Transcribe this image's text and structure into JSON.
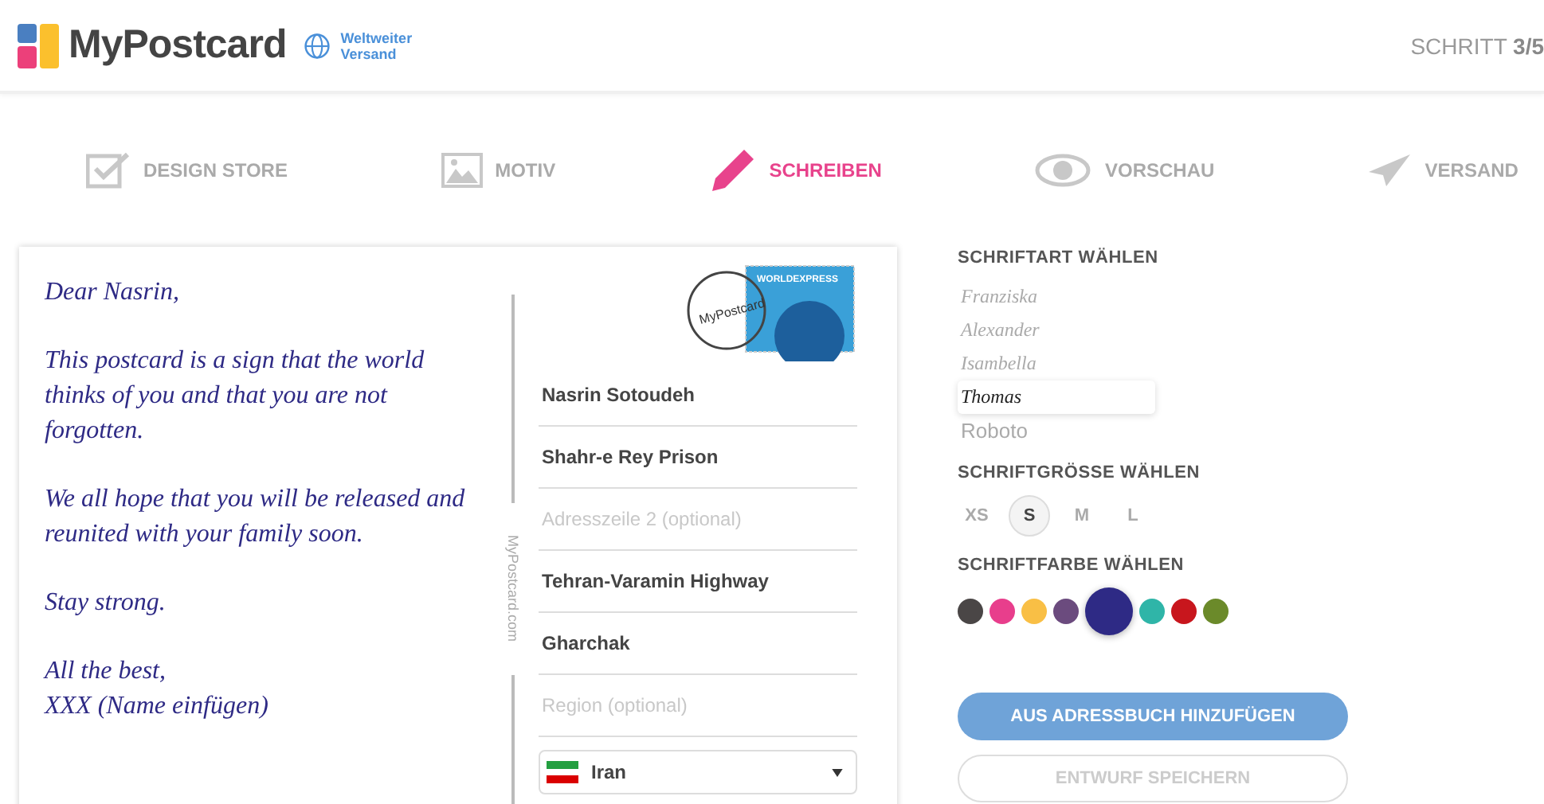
{
  "header": {
    "brand": "MyPostcard",
    "badge_line_1": "Weltweiter",
    "badge_line_2": "Versand",
    "step": "SCHRITT",
    "step_count": "3/5"
  },
  "steps": [
    {
      "label": "DESIGN STORE",
      "kind": "check",
      "selected": false
    },
    {
      "label": "MOTIV",
      "kind": "image",
      "selected": false
    },
    {
      "label": "SCHREIBEN",
      "kind": "pencil",
      "selected": true
    },
    {
      "label": "VORSCHAU",
      "kind": "eye",
      "selected": false
    },
    {
      "label": "VERSAND",
      "kind": "plane",
      "selected": false
    }
  ],
  "postcard": {
    "message": [
      "Dear Nasrin,",
      "This postcard is a sign that the world thinks of you and that you are not forgotten.",
      "We all hope that you will be released and reunited with your family soon.",
      "Stay strong.",
      "All the best,\nXXX (Name einfügen)"
    ],
    "side_text": "MyPostcard.com",
    "stamp_text": "WORLDEXPRESS",
    "postmark_text": "MyPostcard",
    "address": [
      {
        "value": "Nasrin Sotoudeh"
      },
      {
        "value": "Shahr-e Rey Prison"
      },
      {
        "placeholder": "Adresszeile 2 (optional)"
      },
      {
        "value": "Tehran-Varamin Highway"
      },
      {
        "value": "Gharchak"
      },
      {
        "placeholder": "Region (optional)"
      }
    ],
    "country": "Iran"
  },
  "options": {
    "font_title": "SCHRIFTART WÄHLEN",
    "fonts": [
      {
        "label": "Franziska",
        "kind": "script",
        "selected": false
      },
      {
        "label": "Alexander",
        "kind": "script",
        "selected": false
      },
      {
        "label": "Isambella",
        "kind": "script",
        "selected": false
      },
      {
        "label": "Thomas",
        "kind": "script",
        "selected": true
      },
      {
        "label": "Roboto",
        "kind": "sans",
        "selected": false
      }
    ],
    "size_title": "SCHRIFTGRÖSSE WÄHLEN",
    "sizes": [
      {
        "label": "XS",
        "selected": false
      },
      {
        "label": "S",
        "selected": true
      },
      {
        "label": "M",
        "selected": false
      },
      {
        "label": "L",
        "selected": false
      }
    ],
    "color_title": "SCHRIFTFARBE WÄHLEN",
    "colors": [
      {
        "color": "#4a4646",
        "selected": false
      },
      {
        "color": "#e83e8c",
        "selected": false
      },
      {
        "color": "#f9bf45",
        "selected": false
      },
      {
        "color": "#6b4b7e",
        "selected": false
      },
      {
        "color": "#2e2a85",
        "selected": true
      },
      {
        "color": "#2fb5a8",
        "selected": false
      },
      {
        "color": "#c8161d",
        "selected": false
      },
      {
        "color": "#6b8a2a",
        "selected": false
      }
    ],
    "address_book_button": "AUS ADRESSBUCH HINZUFÜGEN",
    "save_button": "ENTWURF SPEICHERN"
  }
}
